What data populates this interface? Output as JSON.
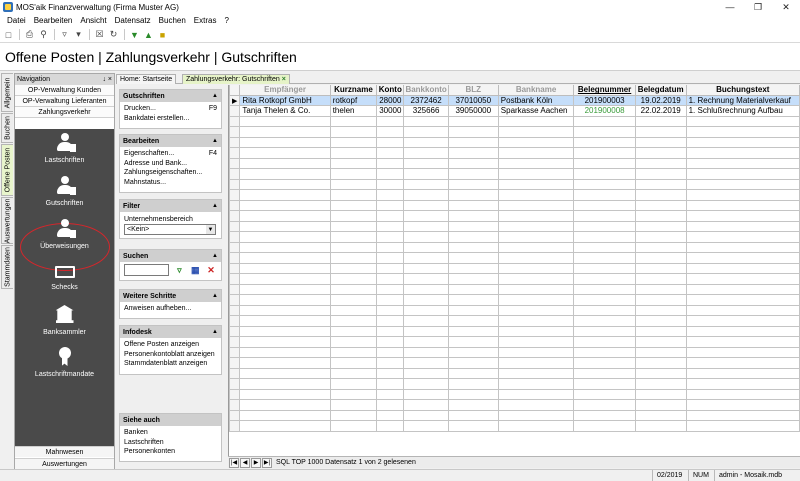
{
  "window": {
    "title": "MOS'aik Finanzverwaltung (Firma Muster AG)"
  },
  "menu": [
    "Datei",
    "Bearbeiten",
    "Ansicht",
    "Datensatz",
    "Buchen",
    "Extras",
    "?"
  ],
  "page": {
    "heading": "Offene Posten | Zahlungsverkehr | Gutschriften"
  },
  "vtabs": [
    "Allgemein",
    "Buchen",
    "Offene Posten",
    "Auswertungen",
    "Stammdaten"
  ],
  "navigation": {
    "title": "Navigation",
    "pin": "↓ ×",
    "links": [
      "OP-Verwaltung Kunden",
      "OP-Verwaltung Lieferanten",
      "Zahlungsverkehr"
    ],
    "tiles": [
      "Lastschriften",
      "Gutschriften",
      "Überweisungen",
      "Schecks",
      "Banksammler",
      "Lastschriftmandate"
    ],
    "bottom": [
      "Mahnwesen",
      "Auswertungen"
    ]
  },
  "tabs": {
    "home": "Home: Startseite",
    "active": "Zahlungsverkehr: Gutschriften",
    "close": "×"
  },
  "tasks": {
    "gutschriften": {
      "title": "Gutschriften",
      "items": [
        {
          "label": "Drucken...",
          "key": "F9"
        },
        {
          "label": "Bankdatei erstellen...",
          "key": ""
        }
      ]
    },
    "bearbeiten": {
      "title": "Bearbeiten",
      "items": [
        {
          "label": "Eigenschaften...",
          "key": "F4"
        },
        {
          "label": "Adresse und Bank...",
          "key": ""
        },
        {
          "label": "Zahlungseigenschaften...",
          "key": ""
        },
        {
          "label": "Mahnstatus...",
          "key": ""
        }
      ]
    },
    "filter": {
      "title": "Filter",
      "label": "Unternehmensbereich",
      "value": "<Kein>"
    },
    "suchen": {
      "title": "Suchen"
    },
    "weitere": {
      "title": "Weitere Schritte",
      "items": [
        {
          "label": "Anweisen aufheben...",
          "key": ""
        }
      ]
    },
    "infodesk": {
      "title": "Infodesk",
      "items": [
        {
          "label": "Offene Posten anzeigen",
          "key": ""
        },
        {
          "label": "Personenkontoblatt anzeigen",
          "key": ""
        },
        {
          "label": "Stammdatenblatt anzeigen",
          "key": ""
        }
      ]
    },
    "siehe": {
      "title": "Siehe auch",
      "items": [
        {
          "label": "Banken",
          "key": ""
        },
        {
          "label": "Lastschriften",
          "key": ""
        },
        {
          "label": "Personenkonten",
          "key": ""
        }
      ]
    }
  },
  "grid": {
    "columns": [
      "Empfänger",
      "Kurzname",
      "Konto",
      "Bankkonto",
      "BLZ",
      "Bankname",
      "Belegnummer",
      "Belegdatum",
      "Buchungstext"
    ],
    "rows": [
      [
        "Rita Rotkopf GmbH",
        "rotkopf",
        "28000",
        "2372462",
        "37010050",
        "Postbank Köln",
        "201900003",
        "19.02.2019",
        "1. Rechnung Materialverkauf"
      ],
      [
        "Tanja Thelen & Co.",
        "thelen",
        "30000",
        "325666",
        "39050000",
        "Sparkasse Aachen",
        "201900008",
        "22.02.2019",
        "1. Schlußrechnung Aufbau"
      ]
    ],
    "footer": "SQL TOP 1000 Datensatz 1 von 2 gelesenen"
  },
  "status": {
    "period": "02/2019",
    "num": "NUM",
    "user": "admin - Mosaik.mdb"
  }
}
